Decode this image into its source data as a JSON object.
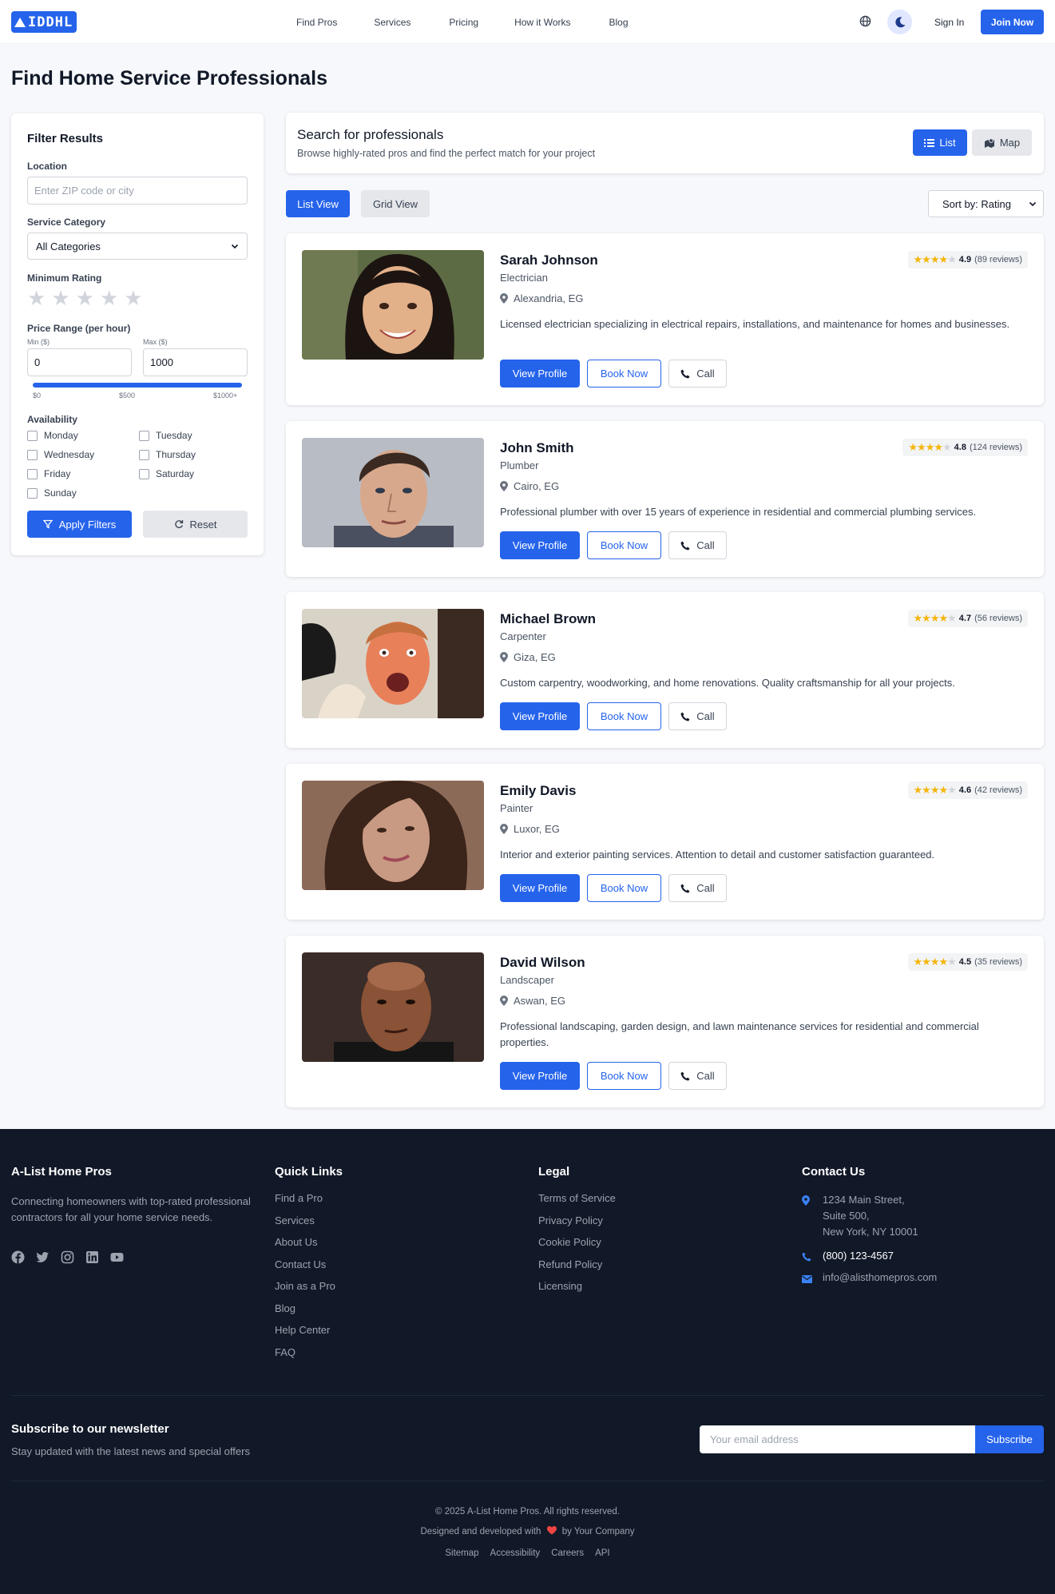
{
  "header": {
    "logo_text": "IDDHL",
    "nav": [
      "Find Pros",
      "Services",
      "Pricing",
      "How it Works",
      "Blog"
    ],
    "sign_in": "Sign In",
    "join": "Join Now"
  },
  "page_title": "Find Home Service Professionals",
  "filters": {
    "title": "Filter Results",
    "location_label": "Location",
    "location_placeholder": "Enter ZIP code or city",
    "category_label": "Service Category",
    "category_value": "All Categories",
    "rating_label": "Minimum Rating",
    "rating_value": 0,
    "price_label": "Price Range (per hour)",
    "min_label": "Min ($)",
    "max_label": "Max ($)",
    "min_value": "0",
    "max_value": "1000",
    "range_ticks": [
      "$0",
      "$500",
      "$1000+"
    ],
    "availability_label": "Availability",
    "days": [
      "Monday",
      "Tuesday",
      "Wednesday",
      "Thursday",
      "Friday",
      "Saturday",
      "Sunday"
    ],
    "apply": "Apply Filters",
    "reset": "Reset"
  },
  "search": {
    "title": "Search for professionals",
    "subtitle": "Browse highly-rated pros and find the perfect match for your project",
    "list": "List",
    "map": "Map",
    "list_view": "List View",
    "grid_view": "Grid View",
    "sort": "Sort by: Rating"
  },
  "pros": [
    {
      "name": "Sarah Johnson",
      "role": "Electrician",
      "location": "Alexandria, EG",
      "rating": "4.9",
      "reviews": "(89 reviews)",
      "desc": "Licensed electrician specializing in electrical repairs, installations, and maintenance for homes and businesses."
    },
    {
      "name": "John Smith",
      "role": "Plumber",
      "location": "Cairo, EG",
      "rating": "4.8",
      "reviews": "(124 reviews)",
      "desc": "Professional plumber with over 15 years of experience in residential and commercial plumbing services."
    },
    {
      "name": "Michael Brown",
      "role": "Carpenter",
      "location": "Giza, EG",
      "rating": "4.7",
      "reviews": "(56 reviews)",
      "desc": "Custom carpentry, woodworking, and home renovations. Quality craftsmanship for all your projects."
    },
    {
      "name": "Emily Davis",
      "role": "Painter",
      "location": "Luxor, EG",
      "rating": "4.6",
      "reviews": "(42 reviews)",
      "desc": "Interior and exterior painting services. Attention to detail and customer satisfaction guaranteed."
    },
    {
      "name": "David Wilson",
      "role": "Landscaper",
      "location": "Aswan, EG",
      "rating": "4.5",
      "reviews": "(35 reviews)",
      "desc": "Professional landscaping, garden design, and lawn maintenance services for residential and commercial properties."
    }
  ],
  "card_buttons": {
    "view": "View Profile",
    "book": "Book Now",
    "call": "Call"
  },
  "footer": {
    "brand": "A-List Home Pros",
    "about": "Connecting homeowners with top-rated professional contractors for all your home service needs.",
    "quick_title": "Quick Links",
    "quick": [
      "Find a Pro",
      "Services",
      "About Us",
      "Contact Us",
      "Join as a Pro",
      "Blog",
      "Help Center",
      "FAQ"
    ],
    "legal_title": "Legal",
    "legal": [
      "Terms of Service",
      "Privacy Policy",
      "Cookie Policy",
      "Refund Policy",
      "Licensing"
    ],
    "contact_title": "Contact Us",
    "address_1": "1234 Main Street,",
    "address_2": "Suite 500,",
    "address_3": "New York, NY 10001",
    "phone": "(800) 123-4567",
    "email": "info@alisthomepros.com",
    "newsletter_title": "Subscribe to our newsletter",
    "newsletter_sub": "Stay updated with the latest news and special offers",
    "newsletter_placeholder": "Your email address",
    "subscribe": "Subscribe",
    "copyright": "© 2025 A-List Home Pros. All rights reserved.",
    "designed_pre": "Designed and developed with",
    "designed_post": "by Your Company",
    "bottom_links": [
      "Sitemap",
      "Accessibility",
      "Careers",
      "API"
    ]
  },
  "colors": {
    "accent": "#2563eb",
    "footer_bg": "#111827",
    "star": "#f5b50a",
    "heart": "#ef4444"
  }
}
